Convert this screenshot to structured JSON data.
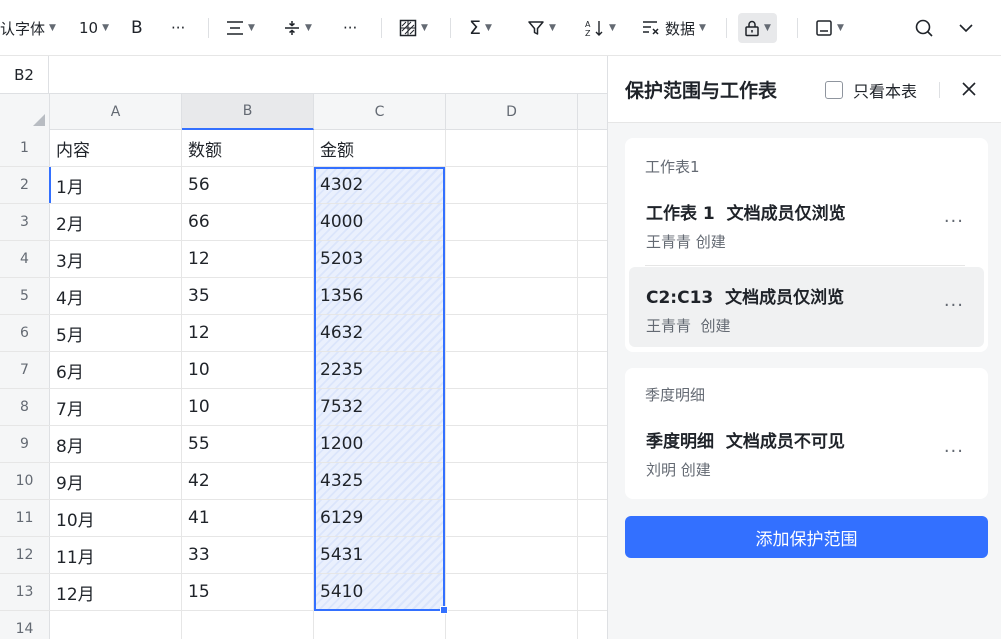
{
  "toolbar": {
    "font_name": "认字体",
    "font_size": "10",
    "bold": "B",
    "more1": "···",
    "more2": "···",
    "data_label": "数据"
  },
  "sheet": {
    "namebox": "B2",
    "columns": [
      "A",
      "B",
      "C",
      "D"
    ],
    "rows": [
      {
        "num": "1",
        "a": "内容",
        "b": "数额",
        "c": "金额"
      },
      {
        "num": "2",
        "a": "1月",
        "b": "56",
        "c": "4302"
      },
      {
        "num": "3",
        "a": "2月",
        "b": "66",
        "c": "4000"
      },
      {
        "num": "4",
        "a": "3月",
        "b": "12",
        "c": "5203"
      },
      {
        "num": "5",
        "a": "4月",
        "b": "35",
        "c": "1356"
      },
      {
        "num": "6",
        "a": "5月",
        "b": "12",
        "c": "4632"
      },
      {
        "num": "7",
        "a": "6月",
        "b": "10",
        "c": "2235"
      },
      {
        "num": "8",
        "a": "7月",
        "b": "10",
        "c": "7532"
      },
      {
        "num": "9",
        "a": "8月",
        "b": "55",
        "c": "1200"
      },
      {
        "num": "10",
        "a": "9月",
        "b": "42",
        "c": "4325"
      },
      {
        "num": "11",
        "a": "10月",
        "b": "41",
        "c": "6129"
      },
      {
        "num": "12",
        "a": "11月",
        "b": "33",
        "c": "5431"
      },
      {
        "num": "13",
        "a": "12月",
        "b": "15",
        "c": "5410"
      },
      {
        "num": "14",
        "a": "",
        "b": "",
        "c": ""
      }
    ]
  },
  "panel": {
    "title": "保护范围与工作表",
    "only_this_sheet": "只看本表",
    "groups": [
      {
        "title": "工作表1",
        "items": [
          {
            "title": "工作表 1  文档成员仅浏览",
            "creator": "王青青 创建"
          },
          {
            "title": "C2:C13  文档成员仅浏览",
            "creator": "王青青  创建"
          }
        ]
      },
      {
        "title": "季度明细",
        "items": [
          {
            "title": "季度明细  文档成员不可见",
            "creator": "刘明 创建"
          }
        ]
      }
    ],
    "add_button": "添加保护范围"
  },
  "colors": {
    "accent": "#3370ff",
    "panel_bg": "#f5f6f7",
    "text": "#1f2329",
    "muted": "#646a73"
  }
}
